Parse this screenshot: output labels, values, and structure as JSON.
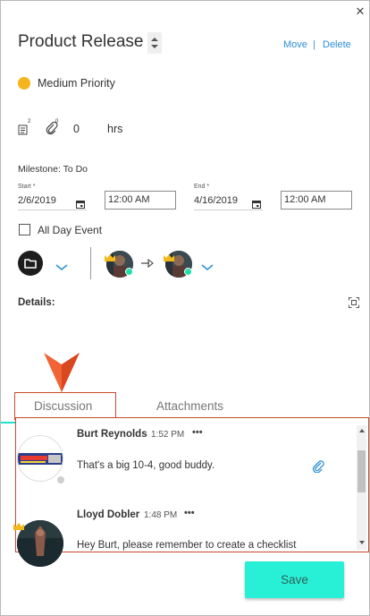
{
  "header": {
    "title": "Product Release",
    "move_label": "Move",
    "separator": "|",
    "delete_label": "Delete",
    "close_glyph": "✕"
  },
  "priority": {
    "label": "Medium Priority",
    "color": "#f5b51c"
  },
  "stats": {
    "notes_count": "2",
    "attachments_count": "0",
    "hours_value": "0",
    "hours_unit": "hrs"
  },
  "milestone": {
    "label": "Milestone: To Do"
  },
  "dates": {
    "start_label": "Start *",
    "start_date": "2/6/2019",
    "start_time": "12:00 AM",
    "end_label": "End *",
    "end_date": "4/16/2019",
    "end_time": "12:00 AM"
  },
  "all_day": {
    "label": "All Day Event",
    "checked": false
  },
  "details": {
    "label": "Details:"
  },
  "tabs": [
    {
      "label": "Discussion",
      "active": true
    },
    {
      "label": "Attachments",
      "active": false
    }
  ],
  "comments": [
    {
      "author": "Burt Reynolds",
      "time": "1:52 PM",
      "more": "•••",
      "text": "That's a big 10-4, good buddy.",
      "has_attachment": true
    },
    {
      "author": "Lloyd Dobler",
      "time": "1:48 PM",
      "more": "•••",
      "text": "Hey Burt, please remember to create a checklist"
    }
  ],
  "actions": {
    "save_label": "Save"
  },
  "colors": {
    "accent": "#28f0d6",
    "link": "#2b8fd6",
    "highlight": "#c94a2b",
    "online": "#1fe0a9"
  },
  "icons": [
    "close-icon",
    "spinner-icon",
    "notes-icon",
    "paperclip-icon",
    "calendar-icon",
    "folder-icon",
    "chevron-down-icon",
    "arrow-right-icon",
    "expand-icon",
    "more-icon",
    "crown-icon"
  ]
}
